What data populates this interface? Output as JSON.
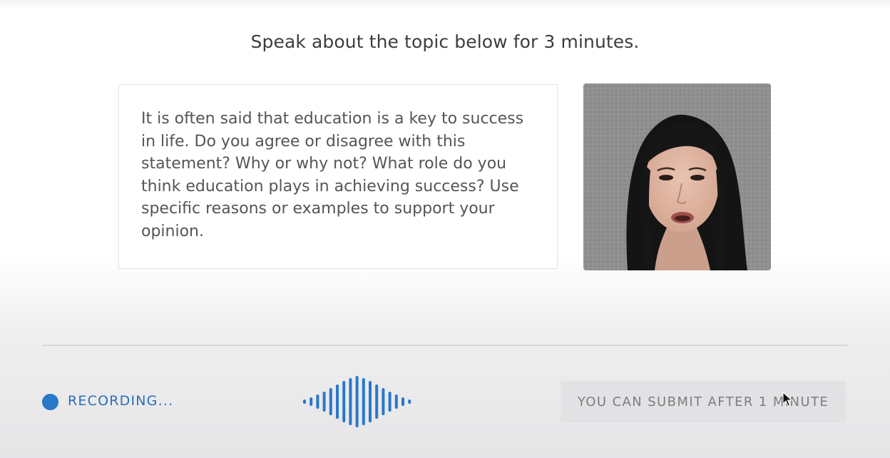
{
  "instruction": "Speak about the topic below for 3 minutes.",
  "prompt": {
    "text": "It is often said that education is a key to success in life. Do you agree or disagree with this statement? Why or why not? What role do you think education plays in achieving success? Use specific reasons or examples to support your opinion."
  },
  "recorder": {
    "status_label": "RECORDING...",
    "status_color": "#2a78c8",
    "waveform_icon": "audio-waveform-icon"
  },
  "submit": {
    "label": "YOU CAN SUBMIT AFTER 1 MINUTE"
  },
  "video": {
    "icon": "webcam-video-feed"
  },
  "colors": {
    "accent": "#2a78c8",
    "waveform": "#2a78c8",
    "button_bg": "#e2e2e4",
    "button_text": "#7d7d80"
  }
}
